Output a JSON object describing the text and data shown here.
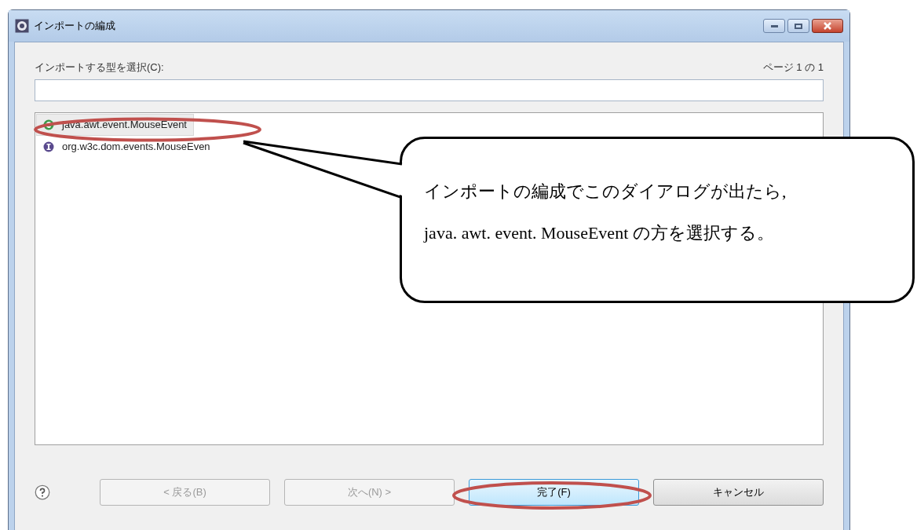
{
  "window": {
    "title": "インポートの編成"
  },
  "prompt": "インポートする型を選択(C):",
  "page_indicator": "ページ 1 の 1",
  "types": [
    {
      "name": "java.awt.event.MouseEvent",
      "kind": "class",
      "selected": true
    },
    {
      "name": "org.w3c.dom.events.MouseEven",
      "kind": "interface",
      "selected": false
    }
  ],
  "buttons": [
    {
      "label": "< 戻る(B)",
      "disabled": true,
      "default": false
    },
    {
      "label": "次へ(N) >",
      "disabled": true,
      "default": false
    },
    {
      "label": "完了(F)",
      "disabled": false,
      "default": true
    },
    {
      "label": "キャンセル",
      "disabled": false,
      "default": false
    }
  ],
  "callout": {
    "lines": [
      "インポートの編成でこのダイアログが出たら,",
      "java. awt. event. MouseEvent の方を選択する。"
    ]
  }
}
